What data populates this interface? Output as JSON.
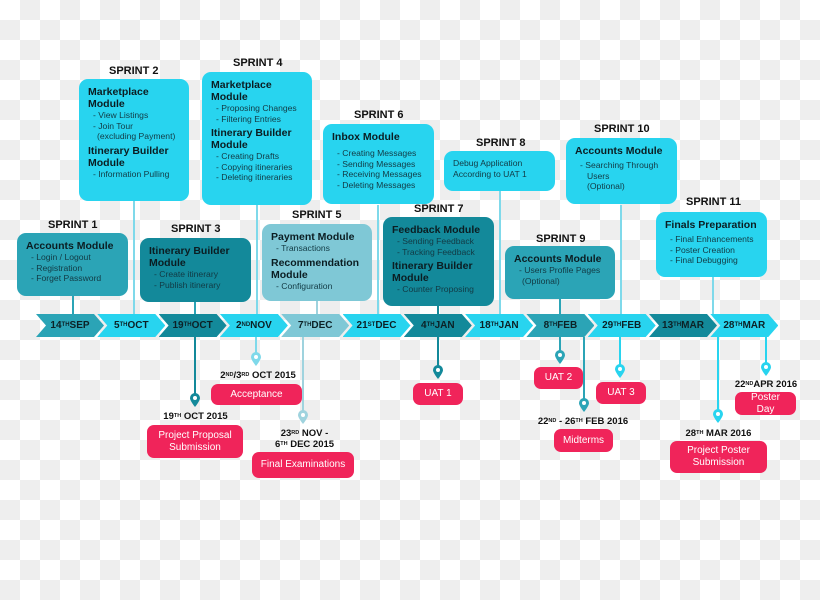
{
  "colors": {
    "bright": "#28d4ef",
    "mid": "#3bbfd6",
    "teal": "#2ba4b6",
    "dark": "#13899a",
    "pale": "#7fc8d6",
    "event": "#f0245a"
  },
  "sprints": [
    {
      "label": "SPRINT 1",
      "modules": [
        {
          "name": "Accounts Module",
          "items": [
            "- Login / Logout",
            "- Registration",
            "- Forget Password"
          ]
        }
      ]
    },
    {
      "label": "SPRINT 2",
      "modules": [
        {
          "name": "Marketplace Module",
          "items": [
            "- View Listings",
            "- Join Tour",
            "  (excluding Payment)"
          ]
        },
        {
          "name": "Itinerary Builder Module",
          "items": [
            "- Information Pulling"
          ]
        }
      ]
    },
    {
      "label": "SPRINT 3",
      "modules": [
        {
          "name": "Itinerary Builder Module",
          "items": [
            "- Create itinerary",
            "- Publish itinerary"
          ]
        }
      ]
    },
    {
      "label": "SPRINT 4",
      "modules": [
        {
          "name": "Marketplace Module",
          "items": [
            "- Proposing Changes",
            "- Filtering Entries"
          ]
        },
        {
          "name": "Itinerary Builder Module",
          "items": [
            "- Creating Drafts",
            "- Copying itineraries",
            "- Deleting itineraries"
          ]
        }
      ]
    },
    {
      "label": "SPRINT 5",
      "modules": [
        {
          "name": "Payment Module",
          "items": [
            "- Transactions"
          ]
        },
        {
          "name": "Recommendation Module",
          "items": [
            "- Configuration"
          ]
        }
      ]
    },
    {
      "label": "SPRINT 6",
      "modules": [
        {
          "name": "Inbox Module",
          "items": [
            "- Creating Messages",
            "- Sending Messages",
            "- Receiving Messages",
            "- Deleting Messages"
          ]
        }
      ]
    },
    {
      "label": "SPRINT 7",
      "modules": [
        {
          "name": "Feedback Module",
          "items": [
            "- Sending Feedback",
            "- Tracking Feedback"
          ]
        },
        {
          "name": "Itinerary Builder Module",
          "items": [
            "- Counter Proposing"
          ]
        }
      ]
    },
    {
      "label": "SPRINT 8",
      "text": [
        "Debug Application",
        "According to UAT 1"
      ]
    },
    {
      "label": "SPRINT 9",
      "modules": [
        {
          "name": "Accounts Module",
          "items": [
            "- Users Profile Pages",
            "(Optional)"
          ]
        }
      ]
    },
    {
      "label": "SPRINT 10",
      "modules": [
        {
          "name": "Accounts Module",
          "items": [
            "- Searching Through",
            "Users",
            "(Optional)"
          ]
        }
      ]
    },
    {
      "label": "SPRINT 11",
      "modules": [
        {
          "name": "Finals Preparation",
          "items": [
            "- Final Enhancements",
            "- Poster Creation",
            "- Final Debugging"
          ]
        }
      ]
    }
  ],
  "timeline": [
    {
      "day": "14",
      "suffix": "TH",
      "month": "SEP"
    },
    {
      "day": "5",
      "suffix": "TH",
      "month": "OCT"
    },
    {
      "day": "19",
      "suffix": "TH",
      "month": "OCT"
    },
    {
      "day": "2",
      "suffix": "ND",
      "month": "NOV"
    },
    {
      "day": "7",
      "suffix": "TH",
      "month": "DEC"
    },
    {
      "day": "21",
      "suffix": "ST",
      "month": "DEC"
    },
    {
      "day": "4",
      "suffix": "TH",
      "month": "JAN"
    },
    {
      "day": "18",
      "suffix": "TH",
      "month": "JAN"
    },
    {
      "day": "8",
      "suffix": "TH",
      "month": "FEB"
    },
    {
      "day": "29",
      "suffix": "TH",
      "month": "FEB"
    },
    {
      "day": "13",
      "suffix": "TH",
      "month": "MAR"
    },
    {
      "day": "28",
      "suffix": "TH",
      "month": "MAR"
    }
  ],
  "events": [
    {
      "date": "2ND/3RD OCT 2015",
      "label": "Acceptance"
    },
    {
      "date": "19TH OCT 2015",
      "label": "Project Proposal Submission"
    },
    {
      "date": "23RD NOV - 6TH DEC 2015",
      "label": "Final Examinations"
    },
    {
      "date": "",
      "label": "UAT 1"
    },
    {
      "date": "",
      "label": "UAT 2"
    },
    {
      "date": "22ND - 26TH FEB 2016",
      "label": "Midterms"
    },
    {
      "date": "",
      "label": "UAT 3"
    },
    {
      "date": "28TH MAR 2016",
      "label": "Project Poster Submission"
    },
    {
      "date": "22ND APR 2016",
      "label": "Poster Day"
    }
  ],
  "event_date_parts": {
    "acceptance": [
      {
        "t": "2"
      },
      {
        "s": "ND"
      },
      {
        "t": "/3"
      },
      {
        "s": "RD"
      },
      {
        "t": " OCT 2015"
      }
    ],
    "proposal": [
      {
        "t": "19"
      },
      {
        "s": "TH"
      },
      {
        "t": " OCT 2015"
      }
    ],
    "exams_1": [
      {
        "t": "23"
      },
      {
        "s": "RD"
      },
      {
        "t": " NOV -"
      }
    ],
    "exams_2": [
      {
        "t": "6"
      },
      {
        "s": "TH"
      },
      {
        "t": " DEC 2015"
      }
    ],
    "midterms": [
      {
        "t": "22"
      },
      {
        "s": "ND"
      },
      {
        "t": " - 26"
      },
      {
        "s": "TH"
      },
      {
        "t": " FEB 2016"
      }
    ],
    "poster_sub": [
      {
        "t": "28"
      },
      {
        "s": "TH"
      },
      {
        "t": " MAR 2016"
      }
    ],
    "poster_day": [
      {
        "t": "22"
      },
      {
        "s": "ND"
      },
      {
        "t": "APR 2016"
      }
    ]
  }
}
